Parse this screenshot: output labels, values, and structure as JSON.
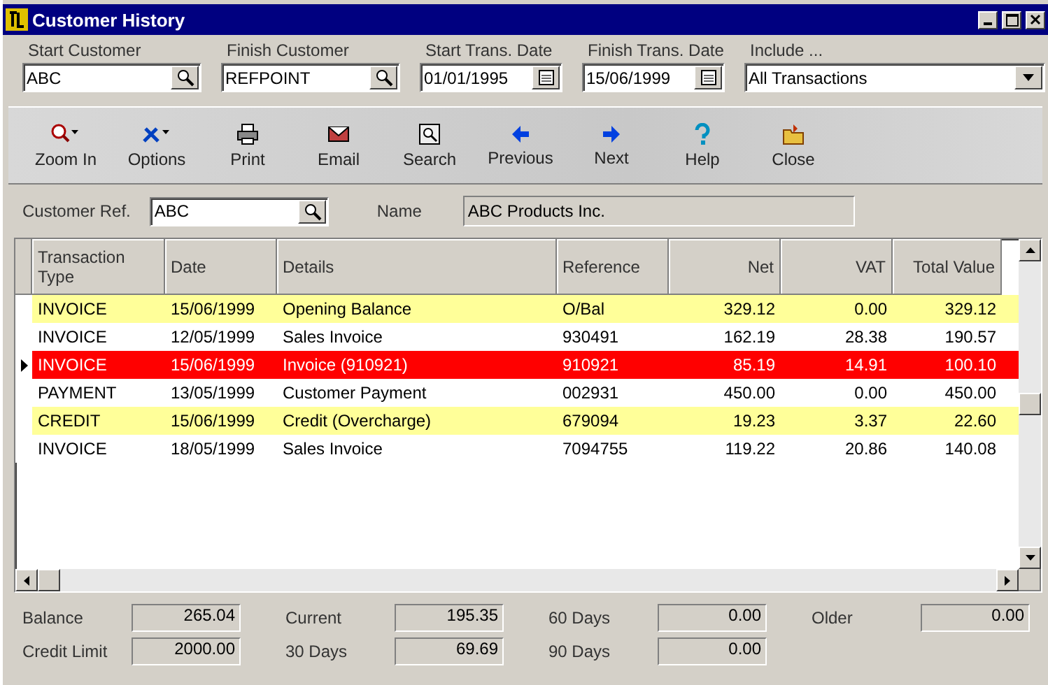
{
  "window": {
    "title": "Customer History"
  },
  "filters": [
    {
      "label": "Start Customer",
      "value": "ABC",
      "kind": "lookup"
    },
    {
      "label": "Finish Customer",
      "value": "REFPOINT",
      "kind": "lookup"
    },
    {
      "label": "Start Trans. Date",
      "value": "01/01/1995",
      "kind": "date"
    },
    {
      "label": "Finish Trans. Date",
      "value": "15/06/1999",
      "kind": "date"
    },
    {
      "label": "Include ...",
      "value": "All Transactions",
      "kind": "dropdown"
    }
  ],
  "toolbar": [
    {
      "label": "Zoom In",
      "kind": "zoom"
    },
    {
      "label": "Options",
      "kind": "options"
    },
    {
      "label": "Print",
      "kind": "print"
    },
    {
      "label": "Email",
      "kind": "email"
    },
    {
      "label": "Search",
      "kind": "search"
    },
    {
      "label": "Previous",
      "kind": "previous"
    },
    {
      "label": "Next",
      "kind": "next"
    },
    {
      "label": "Help",
      "kind": "help"
    },
    {
      "label": "Close",
      "kind": "close"
    }
  ],
  "customer": {
    "ref_label": "Customer Ref.",
    "ref": "ABC",
    "name_label": "Name",
    "name": "ABC Products Inc."
  },
  "table": {
    "columns": [
      "Transaction Type",
      "Date",
      "Details",
      "Reference",
      "Net",
      "VAT",
      "Total Value"
    ],
    "rows": [
      {
        "cells": [
          "INVOICE",
          "15/06/1999",
          "Opening Balance",
          "O/Bal",
          "329.12",
          "0.00",
          "329.12"
        ],
        "color": "#ffff99",
        "selected": false
      },
      {
        "cells": [
          "INVOICE",
          "12/05/1999",
          "Sales Invoice",
          "930491",
          "162.19",
          "28.38",
          "190.57"
        ],
        "color": "#ffffff",
        "selected": false
      },
      {
        "cells": [
          "INVOICE",
          "15/06/1999",
          "Invoice (910921)",
          "910921",
          "85.19",
          "14.91",
          "100.10"
        ],
        "color": "#ff0000",
        "selected": true
      },
      {
        "cells": [
          "PAYMENT",
          "13/05/1999",
          "Customer Payment",
          "002931",
          "450.00",
          "0.00",
          "450.00"
        ],
        "color": "#ffffff",
        "selected": false
      },
      {
        "cells": [
          "CREDIT",
          "15/06/1999",
          "Credit (Overcharge)",
          "679094",
          "19.23",
          "3.37",
          "22.60"
        ],
        "color": "#ffff99",
        "selected": false
      },
      {
        "cells": [
          "INVOICE",
          "18/05/1999",
          "Sales Invoice",
          "7094755",
          "119.22",
          "20.86",
          "140.08"
        ],
        "color": "#ffffff",
        "selected": false
      }
    ]
  },
  "totals": [
    {
      "label": "Balance",
      "value": "265.04"
    },
    {
      "label": "Current",
      "value": "195.35"
    },
    {
      "label": "60 Days",
      "value": "0.00"
    },
    {
      "label": "Older",
      "value": "0.00"
    },
    {
      "label": "Credit Limit",
      "value": "2000.00"
    },
    {
      "label": "30 Days",
      "value": "69.69"
    },
    {
      "label": "90 Days",
      "value": "0.00"
    }
  ]
}
